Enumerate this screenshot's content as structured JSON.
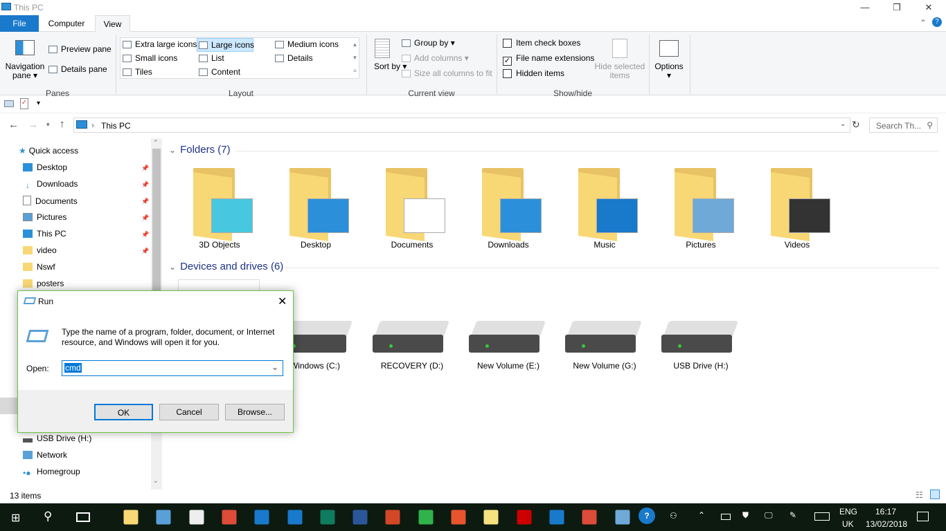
{
  "window": {
    "title": "This PC",
    "minimize": "—",
    "maximize": "❐",
    "close": "✕"
  },
  "tabs": [
    {
      "label": "File"
    },
    {
      "label": "Computer"
    },
    {
      "label": "View"
    }
  ],
  "ribbon": {
    "panes": {
      "navigation_pane": "Navigation pane",
      "preview_pane": "Preview pane",
      "details_pane": "Details pane",
      "group": "Panes"
    },
    "layout": {
      "items": [
        "Extra large icons",
        "Large icons",
        "Medium icons",
        "Small icons",
        "List",
        "Details",
        "Tiles",
        "Content"
      ],
      "selected": "Large icons",
      "group": "Layout"
    },
    "current_view": {
      "sort_by": "Sort by",
      "group_by": "Group by",
      "add_columns": "Add columns",
      "size_columns": "Size all columns to fit",
      "group": "Current view"
    },
    "show_hide": {
      "item_check_boxes": {
        "label": "Item check boxes",
        "checked": false
      },
      "file_name_extensions": {
        "label": "File name extensions",
        "checked": true
      },
      "hidden_items": {
        "label": "Hidden items",
        "checked": false
      },
      "hide_selected": "Hide selected items",
      "group": "Show/hide"
    },
    "options": "Options"
  },
  "address": {
    "path": "This PC",
    "search_placeholder": "Search Th..."
  },
  "nav": {
    "items": [
      {
        "label": "Quick access",
        "pinned": false
      },
      {
        "label": "Desktop",
        "pinned": true
      },
      {
        "label": "Downloads",
        "pinned": true
      },
      {
        "label": "Documents",
        "pinned": true
      },
      {
        "label": "Pictures",
        "pinned": true
      },
      {
        "label": "This PC",
        "pinned": true
      },
      {
        "label": "video",
        "pinned": true
      },
      {
        "label": "Nswf",
        "pinned": false
      },
      {
        "label": "posters",
        "pinned": false
      }
    ],
    "bottom_items": [
      {
        "label": "USB Drive (H:)"
      },
      {
        "label": "Network"
      },
      {
        "label": "Homegroup"
      }
    ]
  },
  "content": {
    "folders_header": "Folders (7)",
    "folders": [
      "3D Objects",
      "Desktop",
      "Documents",
      "Downloads",
      "Music",
      "Pictures",
      "Videos"
    ],
    "devices_header": "Devices and drives (6)",
    "drives": [
      "Windows (C:)",
      "RECOVERY (D:)",
      "New Volume (E:)",
      "New Volume (G:)",
      "USB Drive (H:)"
    ]
  },
  "status": {
    "items": "13 items"
  },
  "run": {
    "title": "Run",
    "description": "Type the name of a program, folder, document, or Internet resource, and Windows will open it for you.",
    "open_label": "Open:",
    "value": "cmd",
    "ok": "OK",
    "cancel": "Cancel",
    "browse": "Browse..."
  },
  "taskbar": {
    "apps": [
      "File Explorer",
      "Devices",
      "Store",
      "Chrome",
      "Security",
      "Search",
      "Publisher",
      "Word",
      "PowerPoint",
      "Camtasia",
      "Camtasia Recorder",
      "Sticky Notes",
      "Creative Cloud",
      "Edge",
      "Chrome 2",
      "Run"
    ],
    "lang1": "ENG",
    "lang2": "UK",
    "time": "16:17",
    "date": "13/02/2018"
  },
  "colors": {
    "accent": "#1979ca",
    "taskbar": "#0c1a10",
    "folder": "#f8d775"
  }
}
